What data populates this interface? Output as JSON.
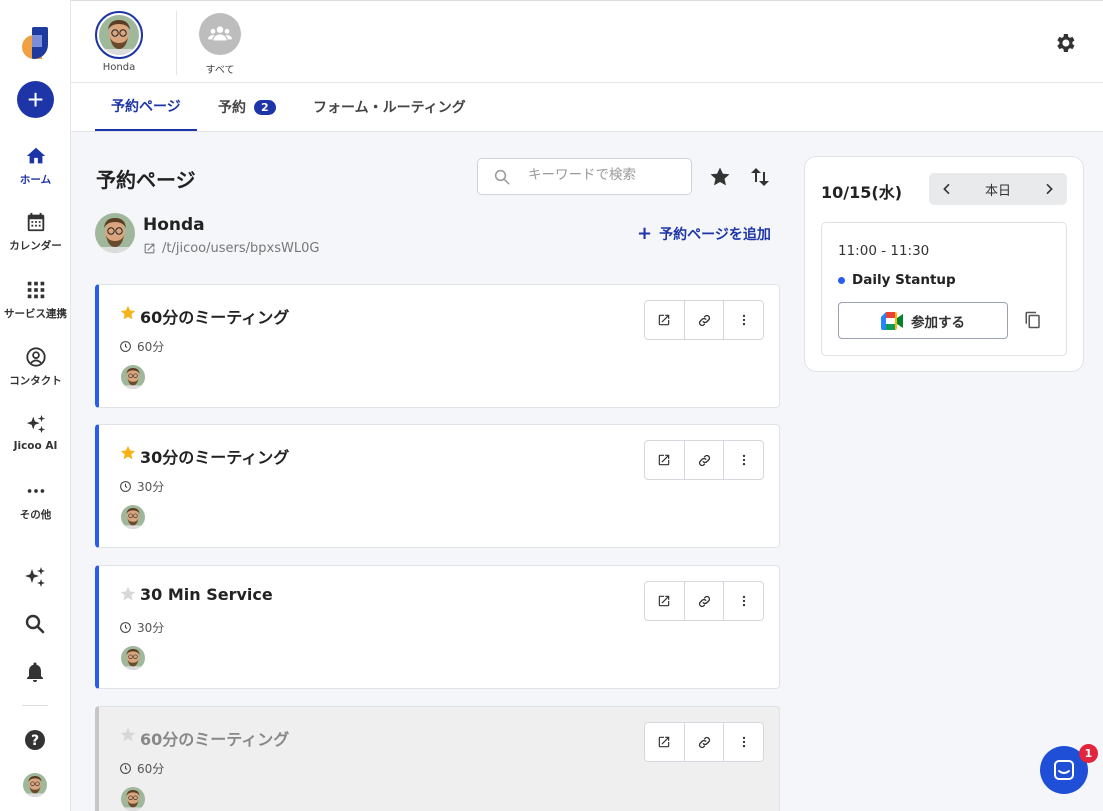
{
  "sidebar": {
    "add_label": "+",
    "items": [
      {
        "label": "ホーム",
        "icon": "home-icon"
      },
      {
        "label": "カレンダー",
        "icon": "calendar-icon"
      },
      {
        "label": "サービス連携",
        "icon": "grid-icon"
      },
      {
        "label": "コンタクト",
        "icon": "contact-icon"
      },
      {
        "label": "Jicoo AI",
        "icon": "sparkle-icon"
      },
      {
        "label": "その他",
        "icon": "more-icon"
      }
    ]
  },
  "topbar": {
    "users": [
      {
        "label": "Honda"
      },
      {
        "label": "すべて"
      }
    ]
  },
  "tabs": [
    {
      "label": "予約ページ"
    },
    {
      "label": "予約",
      "badge": "2"
    },
    {
      "label": "フォーム・ルーティング"
    }
  ],
  "main": {
    "title": "予約ページ",
    "search_placeholder": "キーワードで検索",
    "owner_name": "Honda",
    "owner_url": "/t/jicoo/users/bpxsWL0G",
    "add_page_label": "予約ページを追加",
    "cards": [
      {
        "title": "60分のミーティング",
        "duration": "60分",
        "starred": true,
        "disabled": false
      },
      {
        "title": "30分のミーティング",
        "duration": "30分",
        "starred": true,
        "disabled": false
      },
      {
        "title": "30 Min Service",
        "duration": "30分",
        "starred": false,
        "disabled": false
      },
      {
        "title": "60分のミーティング",
        "duration": "60分",
        "starred": false,
        "disabled": true
      }
    ]
  },
  "schedule": {
    "date": "10/15(水)",
    "today_label": "本日",
    "event_time": "11:00 - 11:30",
    "event_title": "Daily Stantup",
    "join_label": "参加する"
  },
  "chat": {
    "badge": "1"
  },
  "colors": {
    "accent": "#1e35a8",
    "card_border": "#2a5cf0",
    "star": "#f5b319"
  }
}
